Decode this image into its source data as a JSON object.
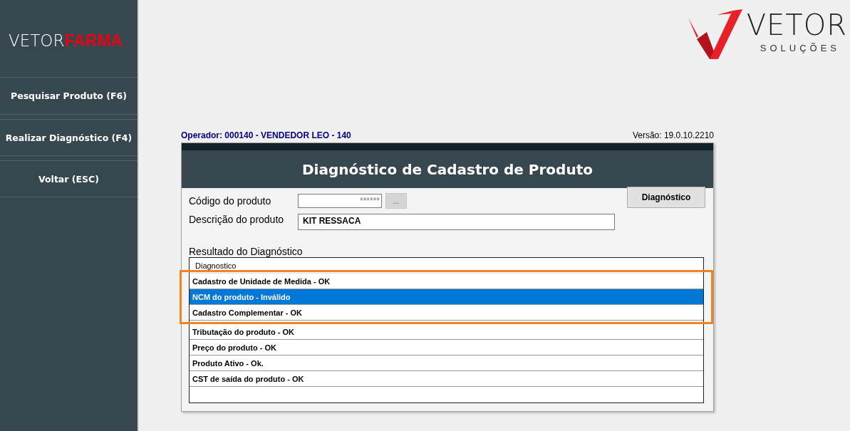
{
  "sidebar": {
    "logo": {
      "text": "VETOR",
      "accent": "FARMA"
    },
    "items": [
      {
        "label": "Pesquisar Produto (F6)"
      },
      {
        "label": "Realizar Diagnóstico (F4)"
      },
      {
        "label": "Voltar (ESC)"
      }
    ]
  },
  "brand": {
    "name": "VETOR",
    "tagline": "SOLUÇÕES"
  },
  "operator": "Operador: 000140 - VENDEDOR LEO - 140",
  "version": "Versão: 19.0.10.2210",
  "panel": {
    "title": "Diagnóstico de Cadastro de Produto",
    "code_label": "Código do produto",
    "code_value": "******",
    "lookup_button": "...",
    "description_label": "Descrição do produto",
    "description_value": "KIT RESSACA",
    "diagnose_button": "Diagnóstico",
    "result_label": "Resultado do Diagnóstico",
    "table": {
      "columns": [
        "Diagnostico"
      ],
      "row_groups": [
        {
          "highlighted": true,
          "rows": [
            {
              "text": "Cadastro de Unidade de Medida - OK",
              "selected": false
            },
            {
              "text": "NCM do produto - Inválido",
              "selected": true
            },
            {
              "text": "Cadastro Complementar - OK",
              "selected": false
            }
          ]
        },
        {
          "highlighted": false,
          "rows": [
            {
              "text": "Tributação do produto - OK",
              "selected": false
            },
            {
              "text": "Preço do produto - OK",
              "selected": false
            },
            {
              "text": "Produto Ativo - Ok.",
              "selected": false
            },
            {
              "text": "CST de saída do produto - OK",
              "selected": false
            }
          ]
        }
      ]
    }
  }
}
